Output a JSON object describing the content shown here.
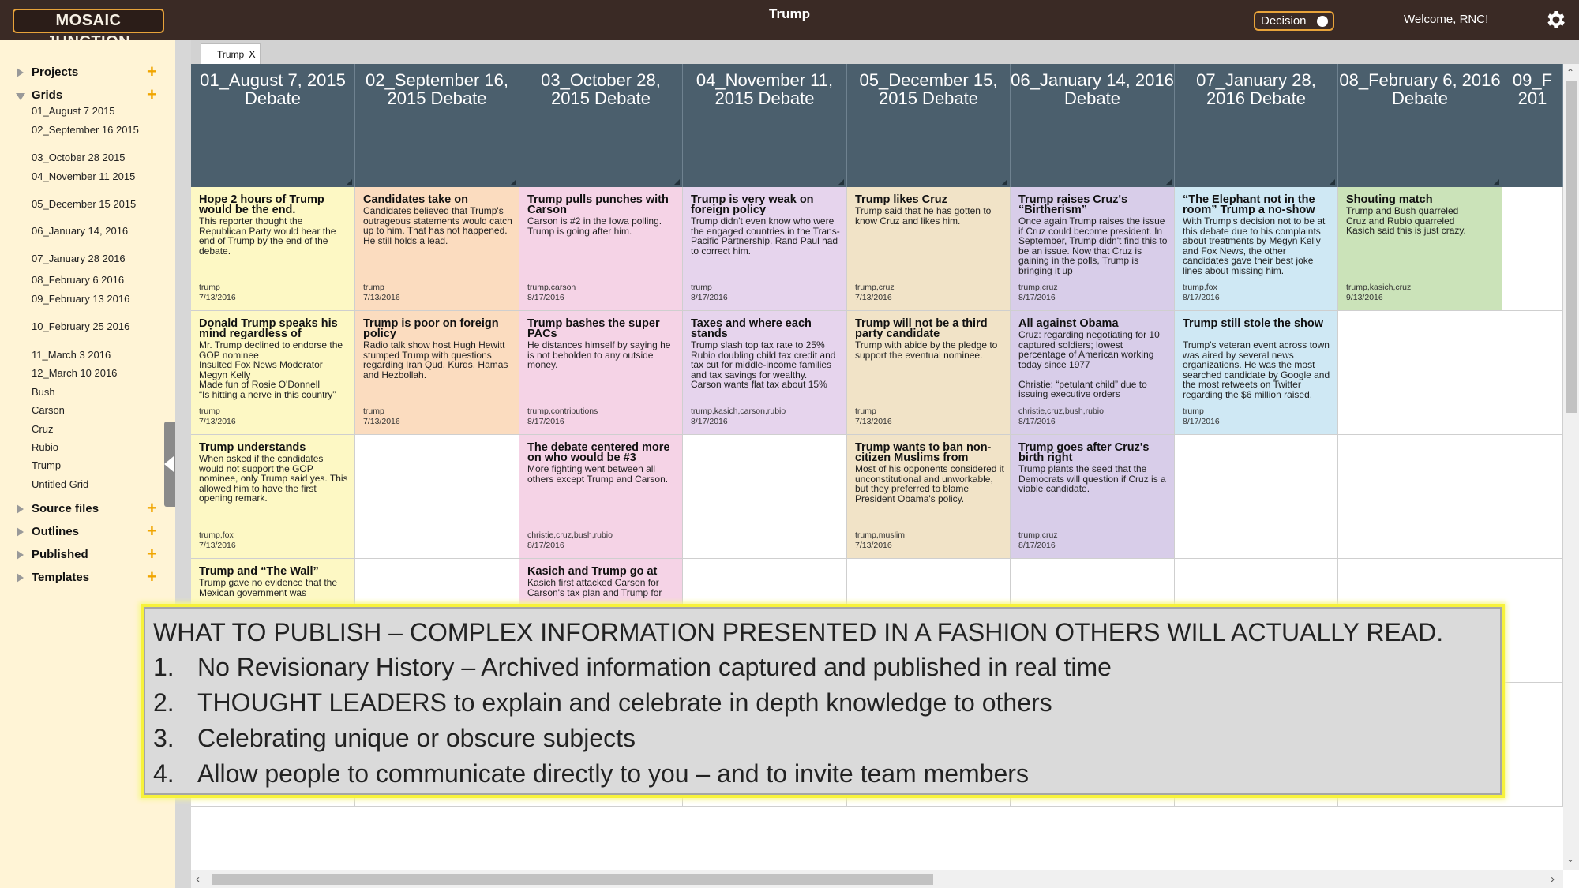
{
  "header": {
    "logo_text": "MOSAIC JUNCTION",
    "title": "Trump",
    "decision_label": "Decision",
    "welcome": "Welcome, RNC!"
  },
  "sidebar": {
    "sections": [
      {
        "label": "Projects",
        "expanded": false
      },
      {
        "label": "Grids",
        "expanded": true
      },
      {
        "label": "Source files",
        "expanded": false
      },
      {
        "label": "Outlines",
        "expanded": false
      },
      {
        "label": "Published",
        "expanded": false
      },
      {
        "label": "Templates",
        "expanded": false
      }
    ],
    "grid_items": [
      "01_August 7 2015",
      "02_September 16 2015",
      "03_October 28 2015",
      "04_November 11 2015",
      "05_December 15 2015",
      "06_January 14, 2016",
      "07_January 28 2016",
      "08_February 6 2016",
      "09_February 13 2016",
      "10_February 25 2016",
      "11_March 3 2016",
      "12_March 10 2016",
      "Bush",
      "Carson",
      "Cruz",
      "Rubio",
      "Trump",
      "Untitled Grid"
    ]
  },
  "tabs": [
    {
      "label": "Trump",
      "close": "X"
    }
  ],
  "grid": {
    "columns": [
      "01_August 7, 2015 Debate",
      "02_September 16, 2015 Debate",
      "03_October 28, 2015 Debate",
      "04_November 11, 2015 Debate",
      "05_December 15, 2015 Debate",
      "06_January 14, 2016 Debate",
      "07_January 28, 2016 Debate",
      "08_February 6, 2016 Debate",
      "09_F 201"
    ],
    "colors": {
      "yellow": "#fdf8c4",
      "orange": "#fbdcbf",
      "pink": "#f5d3e6",
      "purple": "#e6d4ed",
      "tan": "#f1e3c7",
      "lavender": "#d8cde9",
      "blue": "#cfe8f4",
      "green": "#cbe3b9",
      "header": "#4b5f6d"
    },
    "rows": [
      [
        {
          "color": "yellow",
          "title": "Hope 2 hours of Trump would be the end.",
          "body": "This reporter thought the Republican Party would hear the end of Trump by the end of the debate.",
          "tags": "trump",
          "date": "7/13/2016"
        },
        {
          "color": "orange",
          "title": "Candidates take on",
          "body": "Candidates believed that Trump's outrageous statements would catch up to him. That has not happened. He still holds a lead.",
          "tags": "trump",
          "date": "7/13/2016"
        },
        {
          "color": "pink",
          "title": "Trump pulls punches with Carson",
          "body": "Carson is #2 in the Iowa polling. Trump is going after him.",
          "tags": "trump,carson",
          "date": "8/17/2016"
        },
        {
          "color": "purple",
          "title": "Trump is very weak on foreign policy",
          "body": "Trump didn't even know who were the engaged countries in the Trans-Pacific Partnership. Rand Paul had to correct him.",
          "tags": "trump",
          "date": "8/17/2016"
        },
        {
          "color": "tan",
          "title": "Trump likes Cruz",
          "body": "Trump said that he has gotten to know Cruz and likes him.",
          "tags": "trump,cruz",
          "date": "7/13/2016"
        },
        {
          "color": "lavender",
          "title": "Trump raises Cruz's “Birtherism”",
          "body": "Once again Trump raises the issue if Cruz could become president. In September, Trump didn't find this to be an issue. Now that Cruz is gaining in the polls, Trump is bringing it up",
          "tags": "trump,cruz",
          "date": "8/17/2016"
        },
        {
          "color": "blue",
          "title": "“The Elephant not in the room” Trump a no-show",
          "body": "With Trump's decision not to be at this debate due to his complaints about treatments by Megyn Kelly and Fox News, the other candidates gave their best joke lines about missing him.",
          "tags": "trump,fox",
          "date": "8/17/2016"
        },
        {
          "color": "green",
          "title": "Shouting match",
          "body": "Trump and Bush quarreled\nCruz and Rubio quarreled\nKasich said this is just crazy.",
          "tags": "trump,kasich,cruz",
          "date": "9/13/2016"
        },
        null
      ],
      [
        {
          "color": "yellow",
          "title": "Donald Trump speaks his mind regardless of",
          "body": "Mr. Trump declined to endorse the GOP nominee\nInsulted Fox News Moderator Megyn Kelly\nMade fun of Rosie O'Donnell\n“Is hitting a nerve in this country”",
          "tags": "trump",
          "date": "7/13/2016"
        },
        {
          "color": "orange",
          "title": "Trump is poor on foreign policy",
          "body": "Radio talk show host Hugh Hewitt stumped Trump with questions regarding Iran Qud, Kurds, Hamas and Hezbollah.",
          "tags": "trump",
          "date": "7/13/2016"
        },
        {
          "color": "pink",
          "title": "Trump bashes the super PACs",
          "body": "He distances himself by saying he is not beholden to any outside money.",
          "tags": "trump,contributions",
          "date": "8/17/2016"
        },
        {
          "color": "purple",
          "title": "Taxes and where each stands",
          "body": "Trump slash top tax rate to 25%\nRubio doubling child tax credit and tax cut for middle-income families and tax savings for wealthy.\nCarson wants flat tax about 15%",
          "tags": "trump,kasich,carson,rubio",
          "date": "8/17/2016"
        },
        {
          "color": "tan",
          "title": "Trump will not be a third party candidate",
          "body": "Trump with abide by the pledge to support the eventual nominee.",
          "tags": "trump",
          "date": "7/13/2016"
        },
        {
          "color": "lavender",
          "title": "All against Obama",
          "body": "Cruz: regarding negotiating for 10 captured soldiers; lowest percentage of American working today since 1977\n\nChristie: “petulant child” due to issuing executive orders",
          "tags": "christie,cruz,bush,rubio",
          "date": "8/17/2016"
        },
        {
          "color": "blue",
          "title": "Trump still stole the show",
          "body": "Trump's veteran event across town was aired by several news organizations. He was the most searched candidate by Google and the most retweets on Twitter regarding the $6 million raised.",
          "tags": "trump",
          "date": "8/17/2016"
        },
        null,
        null
      ],
      [
        {
          "color": "yellow",
          "title": "Trump understands",
          "body": "When asked if the candidates would not support the GOP nominee, only Trump said yes. This allowed him to have the first opening remark.",
          "tags": "trump,fox",
          "date": "7/13/2016"
        },
        null,
        {
          "color": "pink",
          "title": "The debate centered more on who would be #3",
          "body": "More fighting went between all others except Trump and Carson.",
          "tags": "christie,cruz,bush,rubio",
          "date": "8/17/2016"
        },
        null,
        {
          "color": "tan",
          "title": "Trump wants to ban non-citizen Muslims from",
          "body": "Most of his opponents considered it unconstitutional and unworkable, but they preferred to blame President Obama's policy.",
          "tags": "trump,muslim",
          "date": "7/13/2016"
        },
        {
          "color": "lavender",
          "title": "Trump goes after Cruz's birth right",
          "body": "Trump plants the seed that the Democrats will question if Cruz is a viable candidate.",
          "tags": "trump,cruz",
          "date": "8/17/2016"
        },
        null,
        null,
        null
      ],
      [
        {
          "color": "yellow",
          "title": "Trump and “The Wall”",
          "body": "Trump gave no evidence that the Mexican government was",
          "tags": "",
          "date": ""
        },
        null,
        {
          "color": "pink",
          "title": "Kasich and Trump go at",
          "body": "Kasich first attacked Carson for Carson's tax plan and Trump for",
          "tags": "",
          "date": ""
        },
        null,
        null,
        null,
        null,
        null,
        null
      ]
    ]
  },
  "callout": {
    "headline": "WHAT TO PUBLISH – COMPLEX INFORMATION PRESENTED IN A FASHION OTHERS WILL ACTUALLY READ.",
    "points": [
      {
        "num": "1.",
        "text": "No Revisionary History – Archived information captured and published in real time"
      },
      {
        "num": "2.",
        "text": "THOUGHT LEADERS to explain and celebrate in depth knowledge to others"
      },
      {
        "num": "3.",
        "text": "Celebrating unique or obscure subjects"
      },
      {
        "num": "4.",
        "text": "Allow people to communicate directly to you – and to invite team members"
      }
    ]
  }
}
